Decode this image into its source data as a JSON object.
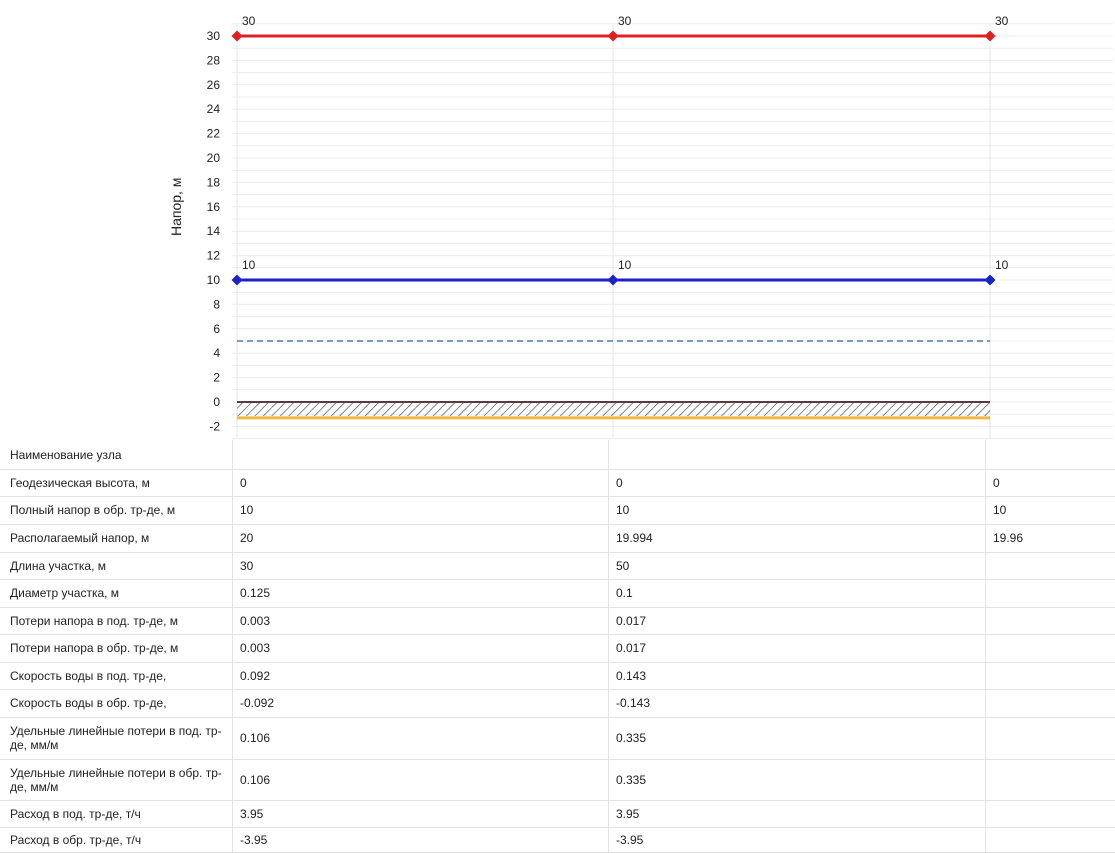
{
  "chart_data": {
    "type": "line",
    "ylabel": "Напор, м",
    "xlabel": "",
    "ylim": [
      -3,
      31
    ],
    "yticks": [
      -2,
      0,
      2,
      4,
      6,
      8,
      10,
      12,
      14,
      16,
      18,
      20,
      22,
      24,
      26,
      28,
      30
    ],
    "x": [
      0,
      30,
      80
    ],
    "grid": true,
    "series": [
      {
        "name": "",
        "values": [
          30,
          30,
          30
        ],
        "point_labels": [
          "30",
          "30",
          "30"
        ],
        "color": "#e02020",
        "style": "solid-markers"
      },
      {
        "name": "",
        "values": [
          10,
          10,
          10
        ],
        "point_labels": [
          "10",
          "10",
          "10"
        ],
        "color": "#1a22c8",
        "style": "solid-markers"
      },
      {
        "name": "",
        "values": [
          5,
          5,
          5
        ],
        "color": "#2a5fa8",
        "style": "dashed"
      },
      {
        "name": "",
        "values": [
          0,
          0,
          0
        ],
        "color": "#5a3a3a",
        "style": "ground-hatch"
      },
      {
        "name": "",
        "values": [
          -1.3,
          -1.3,
          -1.3
        ],
        "color": "#f0b840",
        "style": "solid"
      }
    ]
  },
  "table": {
    "rows": [
      {
        "label": "Наименование узла",
        "values": [
          "",
          "",
          ""
        ]
      },
      {
        "label": "Геодезическая высота, м",
        "values": [
          "0",
          "0",
          "0"
        ]
      },
      {
        "label": "Полный напор в обр. тр-де, м",
        "values": [
          "10",
          "10",
          "10"
        ]
      },
      {
        "label": "Располагаемый напор, м",
        "values": [
          "20",
          "19.994",
          "19.96"
        ]
      },
      {
        "label": "Длина участка, м",
        "values": [
          "30",
          "50",
          ""
        ]
      },
      {
        "label": "Диаметр участка, м",
        "values": [
          "0.125",
          "0.1",
          ""
        ]
      },
      {
        "label": "Потери напора в под. тр-де, м",
        "values": [
          "0.003",
          "0.017",
          ""
        ]
      },
      {
        "label": "Потери напора в обр. тр-де, м",
        "values": [
          "0.003",
          "0.017",
          ""
        ]
      },
      {
        "label": "Скорость воды в под. тр-де,",
        "values": [
          "0.092",
          "0.143",
          ""
        ]
      },
      {
        "label": "Скорость воды в обр. тр-де,",
        "values": [
          "-0.092",
          "-0.143",
          ""
        ]
      },
      {
        "label": "Удельные линейные потери в под. тр-де, мм/м",
        "values": [
          "0.106",
          "0.335",
          ""
        ]
      },
      {
        "label": "Удельные линейные потери в обр. тр-де, мм/м",
        "values": [
          "0.106",
          "0.335",
          ""
        ]
      },
      {
        "label": "Расход в под. тр-де, т/ч",
        "values": [
          "3.95",
          "3.95",
          ""
        ]
      },
      {
        "label": "Расход в обр. тр-де, т/ч",
        "values": [
          "-3.95",
          "-3.95",
          ""
        ]
      }
    ]
  }
}
